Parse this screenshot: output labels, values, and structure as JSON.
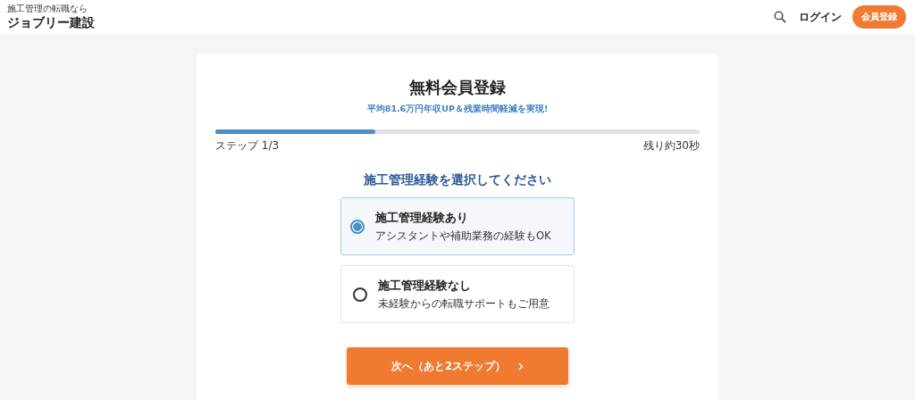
{
  "header": {
    "tagline": "施工管理の転職なら",
    "logo": "ジョブリー建設",
    "login": "ログイン",
    "register": "会員登録"
  },
  "card": {
    "title": "無料会員登録",
    "subtitle": "平均81.6万円年収UP＆残業時間軽減を実現!",
    "progress": {
      "level": 0.33,
      "step": "ステップ 1/3",
      "remaining": "残り約30秒"
    },
    "question": "施工管理経験を選択してください",
    "options": [
      {
        "label": "施工管理経験あり",
        "description": "アシスタントや補助業務の経験もOK",
        "selected": true
      },
      {
        "label": "施工管理経験なし",
        "description": "未経験からの転職サポートもご用意",
        "selected": false
      }
    ],
    "next_button": "次へ（あと2ステップ）"
  }
}
